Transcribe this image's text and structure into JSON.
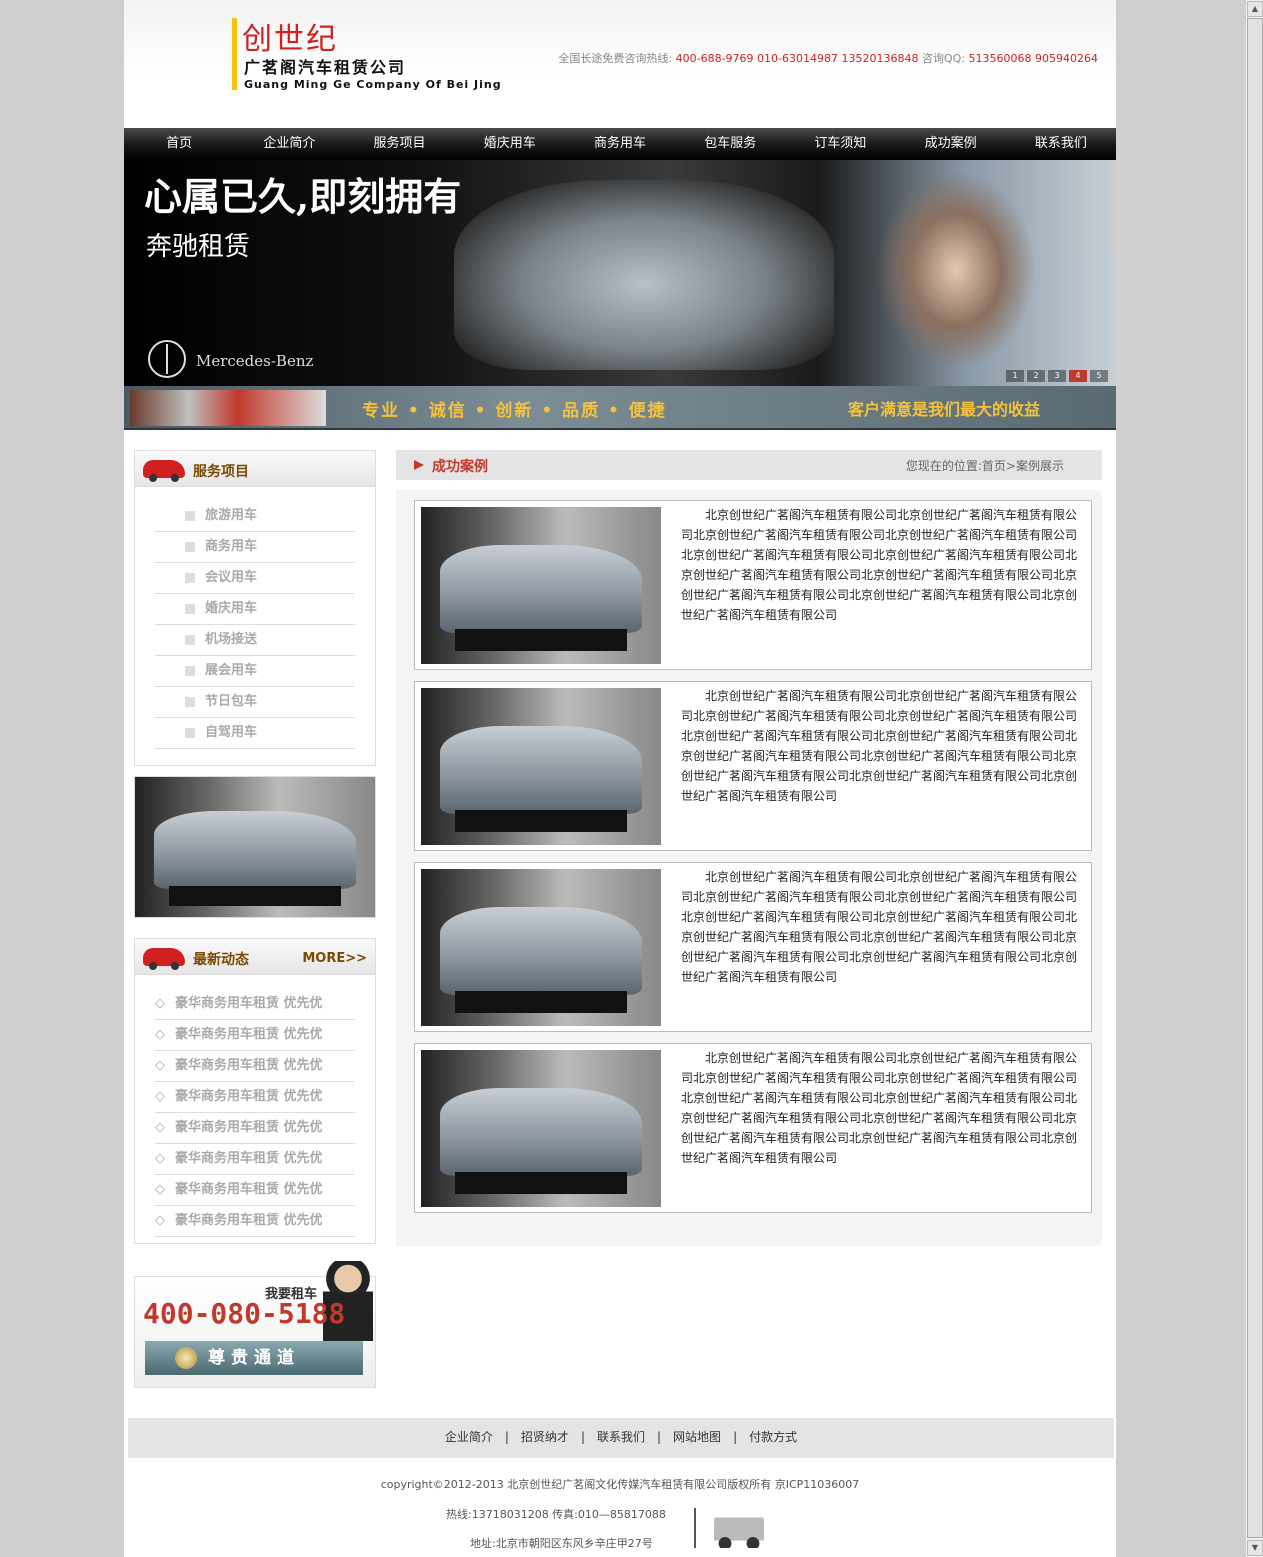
{
  "header": {
    "logo_cn": "创世纪",
    "company": "广茗阁汽车租赁公司",
    "company_en": "Guang Ming Ge Company Of Bei Jing",
    "hotline_label": "全国长途免费咨询热线:",
    "hotline_numbers": "400-688-9769   010-63014987  13520136848",
    "qq_label": "咨询QQ:",
    "qq_numbers": "513560068  905940264"
  },
  "nav": [
    "首页",
    "企业简介",
    "服务项目",
    "婚庆用车",
    "商务用车",
    "包车服务",
    "订车须知",
    "成功案例",
    "联系我们"
  ],
  "banner": {
    "title": "心属已久,即刻拥有",
    "subtitle": "奔驰租赁",
    "brand": "Mercedes-Benz",
    "dots": [
      "1",
      "2",
      "3",
      "4",
      "5"
    ],
    "active_dot": 4
  },
  "slogan": {
    "main": "专业 • 诚信 • 创新 • 品质 • 便捷",
    "right": "客户满意是我们最大的收益"
  },
  "services": {
    "title": "服务项目",
    "items": [
      "旅游用车",
      "商务用车",
      "会议用车",
      "婚庆用车",
      "机场接送",
      "展会用车",
      "节日包车",
      "自驾用车"
    ]
  },
  "news": {
    "title": "最新动态",
    "more": "MORE>>",
    "items": [
      "豪华商务用车租赁 优先优",
      "豪华商务用车租赁 优先优",
      "豪华商务用车租赁 优先优",
      "豪华商务用车租赁 优先优",
      "豪华商务用车租赁 优先优",
      "豪华商务用车租赁 优先优",
      "豪华商务用车租赁 优先优",
      "豪华商务用车租赁 优先优"
    ]
  },
  "tel_box": {
    "want": "我要租车",
    "number": "400-080-5188",
    "vip": "尊贵通道"
  },
  "main": {
    "title": "成功案例",
    "breadcrumb": "您现在的位置:首页>案例展示",
    "cases": [
      "北京创世纪广茗阁汽车租赁有限公司北京创世纪广茗阁汽车租赁有限公司北京创世纪广茗阁汽车租赁有限公司北京创世纪广茗阁汽车租赁有限公司北京创世纪广茗阁汽车租赁有限公司北京创世纪广茗阁汽车租赁有限公司北京创世纪广茗阁汽车租赁有限公司北京创世纪广茗阁汽车租赁有限公司北京创世纪广茗阁汽车租赁有限公司北京创世纪广茗阁汽车租赁有限公司北京创世纪广茗阁汽车租赁有限公司",
      "北京创世纪广茗阁汽车租赁有限公司北京创世纪广茗阁汽车租赁有限公司北京创世纪广茗阁汽车租赁有限公司北京创世纪广茗阁汽车租赁有限公司北京创世纪广茗阁汽车租赁有限公司北京创世纪广茗阁汽车租赁有限公司北京创世纪广茗阁汽车租赁有限公司北京创世纪广茗阁汽车租赁有限公司北京创世纪广茗阁汽车租赁有限公司北京创世纪广茗阁汽车租赁有限公司北京创世纪广茗阁汽车租赁有限公司",
      "北京创世纪广茗阁汽车租赁有限公司北京创世纪广茗阁汽车租赁有限公司北京创世纪广茗阁汽车租赁有限公司北京创世纪广茗阁汽车租赁有限公司北京创世纪广茗阁汽车租赁有限公司北京创世纪广茗阁汽车租赁有限公司北京创世纪广茗阁汽车租赁有限公司北京创世纪广茗阁汽车租赁有限公司北京创世纪广茗阁汽车租赁有限公司北京创世纪广茗阁汽车租赁有限公司北京创世纪广茗阁汽车租赁有限公司",
      "北京创世纪广茗阁汽车租赁有限公司北京创世纪广茗阁汽车租赁有限公司北京创世纪广茗阁汽车租赁有限公司北京创世纪广茗阁汽车租赁有限公司北京创世纪广茗阁汽车租赁有限公司北京创世纪广茗阁汽车租赁有限公司北京创世纪广茗阁汽车租赁有限公司北京创世纪广茗阁汽车租赁有限公司北京创世纪广茗阁汽车租赁有限公司北京创世纪广茗阁汽车租赁有限公司北京创世纪广茗阁汽车租赁有限公司"
    ]
  },
  "footer": {
    "links": [
      "企业简介",
      "招贤纳才",
      "联系我们",
      "网站地图",
      "付款方式"
    ],
    "copyright": "copyright©2012-2013  北京创世纪广茗阁文化传媒汽车租赁有限公司版权所有  京ICP11036007",
    "hotline": "热线:13718031208   传真:010—85817088",
    "address": "地址:北京市朝阳区东风乡辛庄甲27号"
  }
}
